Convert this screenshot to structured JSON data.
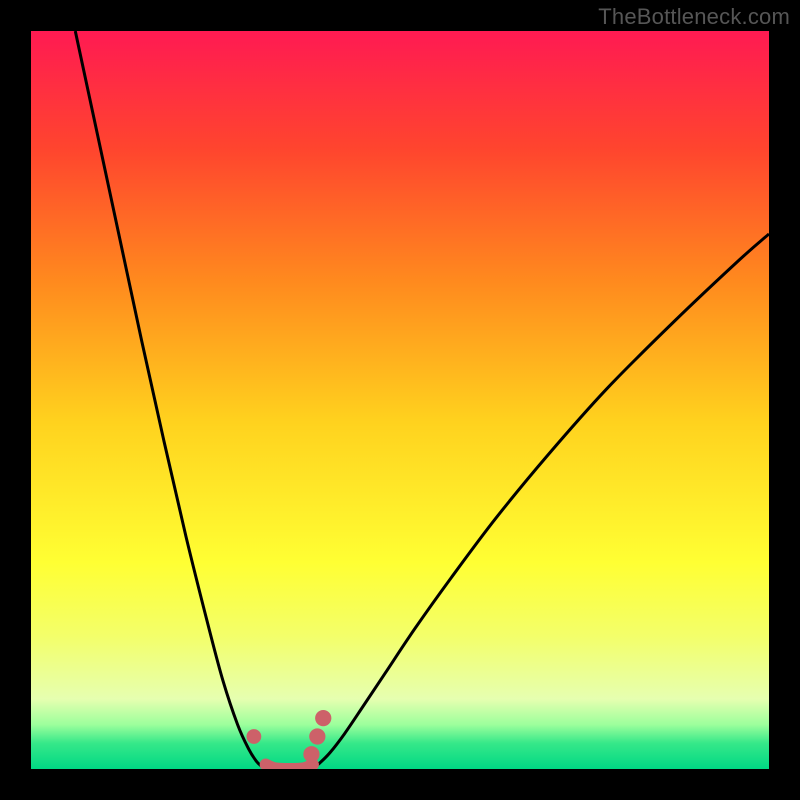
{
  "watermark": "TheBottleneck.com",
  "chart_data": {
    "type": "line",
    "title": "",
    "xlabel": "",
    "ylabel": "",
    "xlim": [
      0,
      100
    ],
    "ylim": [
      0,
      100
    ],
    "grid": false,
    "legend": false,
    "background_gradient": {
      "orientation": "vertical",
      "stops": [
        {
          "pos": 0.0,
          "color": "#ff1a52"
        },
        {
          "pos": 0.16,
          "color": "#ff452e"
        },
        {
          "pos": 0.34,
          "color": "#ff8a1e"
        },
        {
          "pos": 0.53,
          "color": "#ffd21e"
        },
        {
          "pos": 0.72,
          "color": "#ffff33"
        },
        {
          "pos": 0.82,
          "color": "#f3ff6a"
        },
        {
          "pos": 0.905,
          "color": "#e6ffb0"
        },
        {
          "pos": 0.94,
          "color": "#9cff9c"
        },
        {
          "pos": 0.965,
          "color": "#36e889"
        },
        {
          "pos": 1.0,
          "color": "#00d884"
        }
      ]
    },
    "series": [
      {
        "name": "curve-left",
        "stroke": "#000000",
        "stroke_width": 3,
        "x": [
          6.0,
          9.0,
          12.0,
          15.0,
          18.0,
          21.0,
          24.0,
          26.0,
          28.0,
          29.5,
          30.5,
          31.2,
          31.8
        ],
        "y": [
          100.0,
          86.0,
          72.0,
          58.0,
          44.5,
          31.5,
          19.5,
          12.0,
          6.0,
          2.7,
          1.1,
          0.4,
          0.1
        ]
      },
      {
        "name": "curve-right",
        "stroke": "#000000",
        "stroke_width": 3,
        "x": [
          38.2,
          39.0,
          40.5,
          42.5,
          45.0,
          48.0,
          52.0,
          57.0,
          63.0,
          70.0,
          78.0,
          87.0,
          96.0,
          100.0
        ],
        "y": [
          0.1,
          0.7,
          2.2,
          4.8,
          8.5,
          13.0,
          19.0,
          26.0,
          34.0,
          42.5,
          51.5,
          60.5,
          69.0,
          72.5
        ]
      },
      {
        "name": "floor-segment",
        "stroke": "#cd6169",
        "stroke_width": 12,
        "linecap": "round",
        "x": [
          31.8,
          33.0,
          35.0,
          37.0,
          38.2
        ],
        "y": [
          0.6,
          0.1,
          0.0,
          0.1,
          0.6
        ]
      }
    ],
    "markers": [
      {
        "name": "dot-left",
        "shape": "circle",
        "x": 30.2,
        "y": 4.4,
        "r": 1.0,
        "fill": "#cd6169"
      },
      {
        "name": "dot-right-1",
        "shape": "circle",
        "x": 38.0,
        "y": 2.0,
        "r": 1.1,
        "fill": "#cd6169"
      },
      {
        "name": "dot-right-2",
        "shape": "circle",
        "x": 38.8,
        "y": 4.4,
        "r": 1.1,
        "fill": "#cd6169"
      },
      {
        "name": "dot-right-3",
        "shape": "circle",
        "x": 39.6,
        "y": 6.9,
        "r": 1.1,
        "fill": "#cd6169"
      }
    ]
  }
}
